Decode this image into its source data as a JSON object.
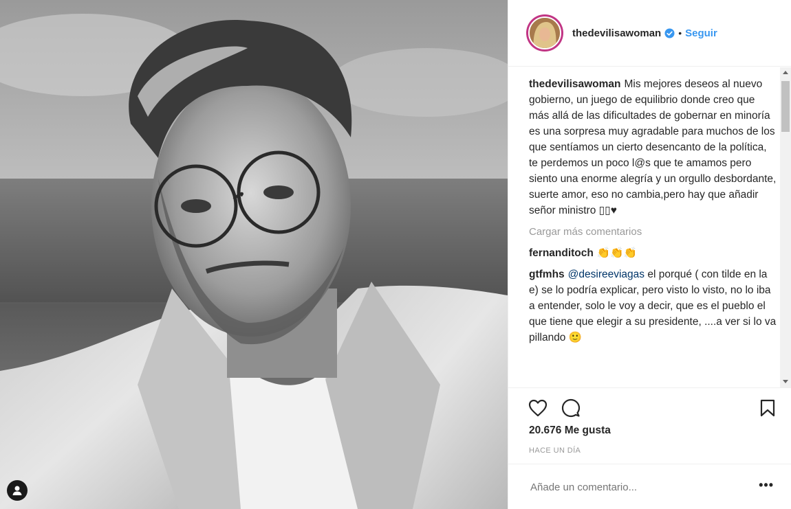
{
  "post": {
    "username": "thedevilisawoman",
    "follow_label": "Seguir",
    "dot": "•",
    "caption": "Mis mejores deseos al nuevo gobierno, un juego de equilibrio donde creo que más allá de las dificultades de gobernar en minoría es una sorpresa muy agradable para muchos de los que sentíamos un cierto desencanto de la política, te perdemos un poco l@s que te amamos pero siento una enorme alegría y un orgullo desbordante, suerte amor, eso no cambia,pero hay que añadir señor ministro ▯▯♥",
    "load_more": "Cargar más comentarios",
    "comments": [
      {
        "user": "fernanditoch",
        "text": "👏👏👏"
      },
      {
        "user": "gtfmhs",
        "mention": "@desireeviagas",
        "text": "el porqué ( con tilde en la e) se lo podría explicar, pero visto lo visto, no lo iba a entender, solo le voy a decir, que es el pueblo el que tiene que elegir a su presidente, ....a ver si lo va pillando 🙂"
      }
    ],
    "likes": "20.676 Me gusta",
    "time": "HACE UN DÍA",
    "comment_placeholder": "Añade un comentario...",
    "more": "•••"
  },
  "colors": {
    "accent": "#3897f0",
    "verified": "#3897f0",
    "mention": "#003569",
    "muted": "#999999"
  }
}
